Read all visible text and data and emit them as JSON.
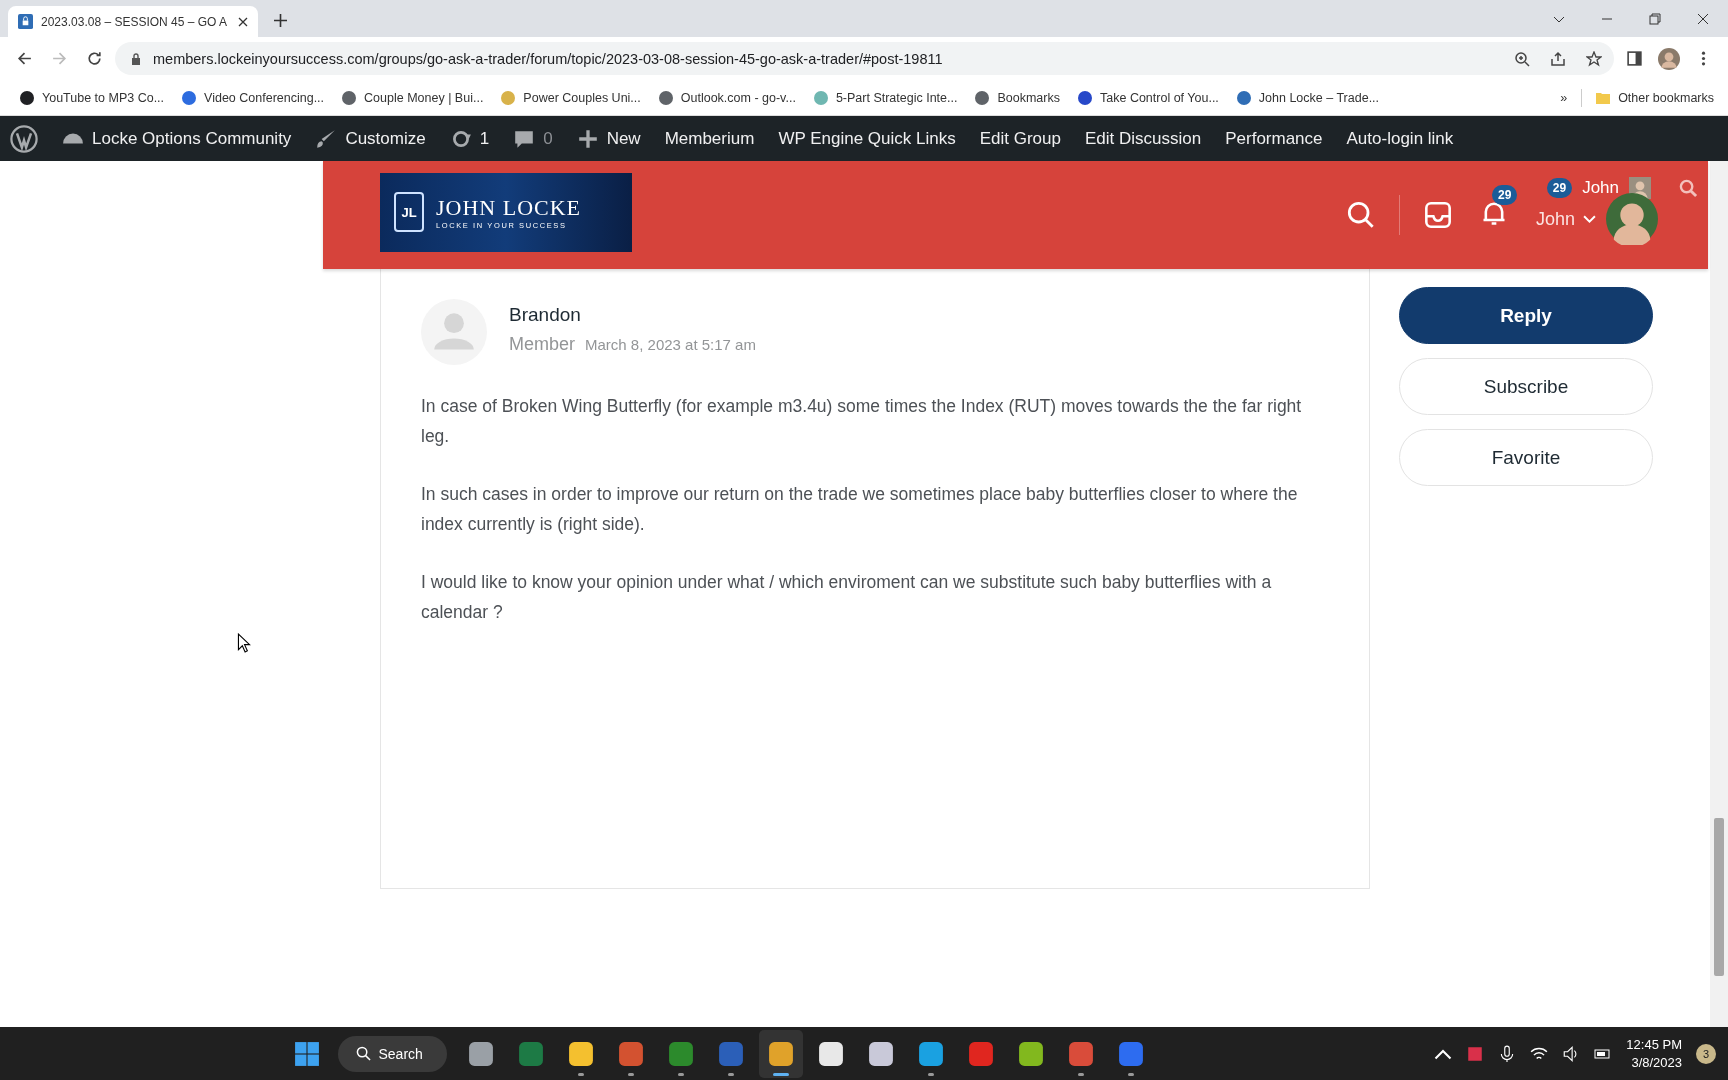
{
  "browser": {
    "tabs": [
      {
        "title": "2023.03.08 – SESSION 45 – GO A",
        "selected": true
      }
    ],
    "url": "members.lockeinyoursuccess.com/groups/go-ask-a-trader/forum/topic/2023-03-08-session-45-go-ask-a-trader/#post-19811",
    "bookmarks": [
      {
        "label": "YouTube to MP3 Co...",
        "color": "#202124"
      },
      {
        "label": "Video Conferencing...",
        "color": "#2d6cdf"
      },
      {
        "label": "Couple Money | Bui...",
        "color": "#5f6368"
      },
      {
        "label": "Power Couples Uni...",
        "color": "#d8b24a"
      },
      {
        "label": "Outlook.com - go-v...",
        "color": "#5f6368"
      },
      {
        "label": "5-Part Strategic Inte...",
        "color": "#6fb7b1"
      },
      {
        "label": "Bookmarks",
        "color": "#5f6368"
      },
      {
        "label": "Take Control of You...",
        "color": "#2748c9"
      },
      {
        "label": "John Locke – Trade...",
        "color": "#2f6db5"
      }
    ],
    "overflow": "»",
    "other_bookmarks": "Other bookmarks"
  },
  "admin_bar": {
    "site": "Locke Options Community",
    "customize": "Customize",
    "updates": "1",
    "comments": "0",
    "new": "New",
    "links": [
      "Memberium",
      "WP Engine Quick Links",
      "Edit Group",
      "Edit Discussion",
      "Performance",
      "Auto-login link"
    ]
  },
  "header": {
    "logo": {
      "monogram": "JL",
      "title": "JOHN LOCKE",
      "tagline": "LOCKE IN YOUR SUCCESS"
    },
    "notifications": "29",
    "user": "John",
    "top_count": "29",
    "top_user": "John"
  },
  "post": {
    "author": "Brandon",
    "role": "Member",
    "date": "March 8, 2023 at 5:17 am",
    "paragraphs": [
      "In case of Broken Wing Butterfly (for example m3.4u) some times the Index (RUT) moves towards the the far right leg.",
      "In such cases in order to improve our return on the trade we sometimes place baby butterflies closer to where the index currently is (right side).",
      "I would like to know your opinion under what / which enviroment can we substitute such baby butterflies with a calendar ?"
    ]
  },
  "actions": [
    {
      "label": "Reply",
      "kind": "primary"
    },
    {
      "label": "Subscribe",
      "kind": "outline"
    },
    {
      "label": "Favorite",
      "kind": "outline"
    }
  ],
  "taskbar": {
    "search": "Search",
    "apps": [
      {
        "color": "#9aa0a6",
        "running": false,
        "selected": false
      },
      {
        "color": "#1d7a45",
        "running": false,
        "selected": false
      },
      {
        "color": "#f4c02f",
        "running": true,
        "selected": false
      },
      {
        "color": "#d35230",
        "running": true,
        "selected": false
      },
      {
        "color": "#2c8a2c",
        "running": true,
        "selected": false
      },
      {
        "color": "#2b5fb8",
        "running": true,
        "selected": false
      },
      {
        "color": "#e0a22a",
        "running": true,
        "selected": true
      },
      {
        "color": "#e8e8e8",
        "running": false,
        "selected": false
      },
      {
        "color": "#c9c9d9",
        "running": false,
        "selected": false
      },
      {
        "color": "#1aa1e1",
        "running": true,
        "selected": false
      },
      {
        "color": "#e0261f",
        "running": false,
        "selected": false
      },
      {
        "color": "#82b81e",
        "running": false,
        "selected": false
      },
      {
        "color": "#d94c3a",
        "running": true,
        "selected": false
      },
      {
        "color": "#2d6cf0",
        "running": true,
        "selected": false
      }
    ],
    "time": "12:45 PM",
    "date": "3/8/2023",
    "badge": "3"
  }
}
